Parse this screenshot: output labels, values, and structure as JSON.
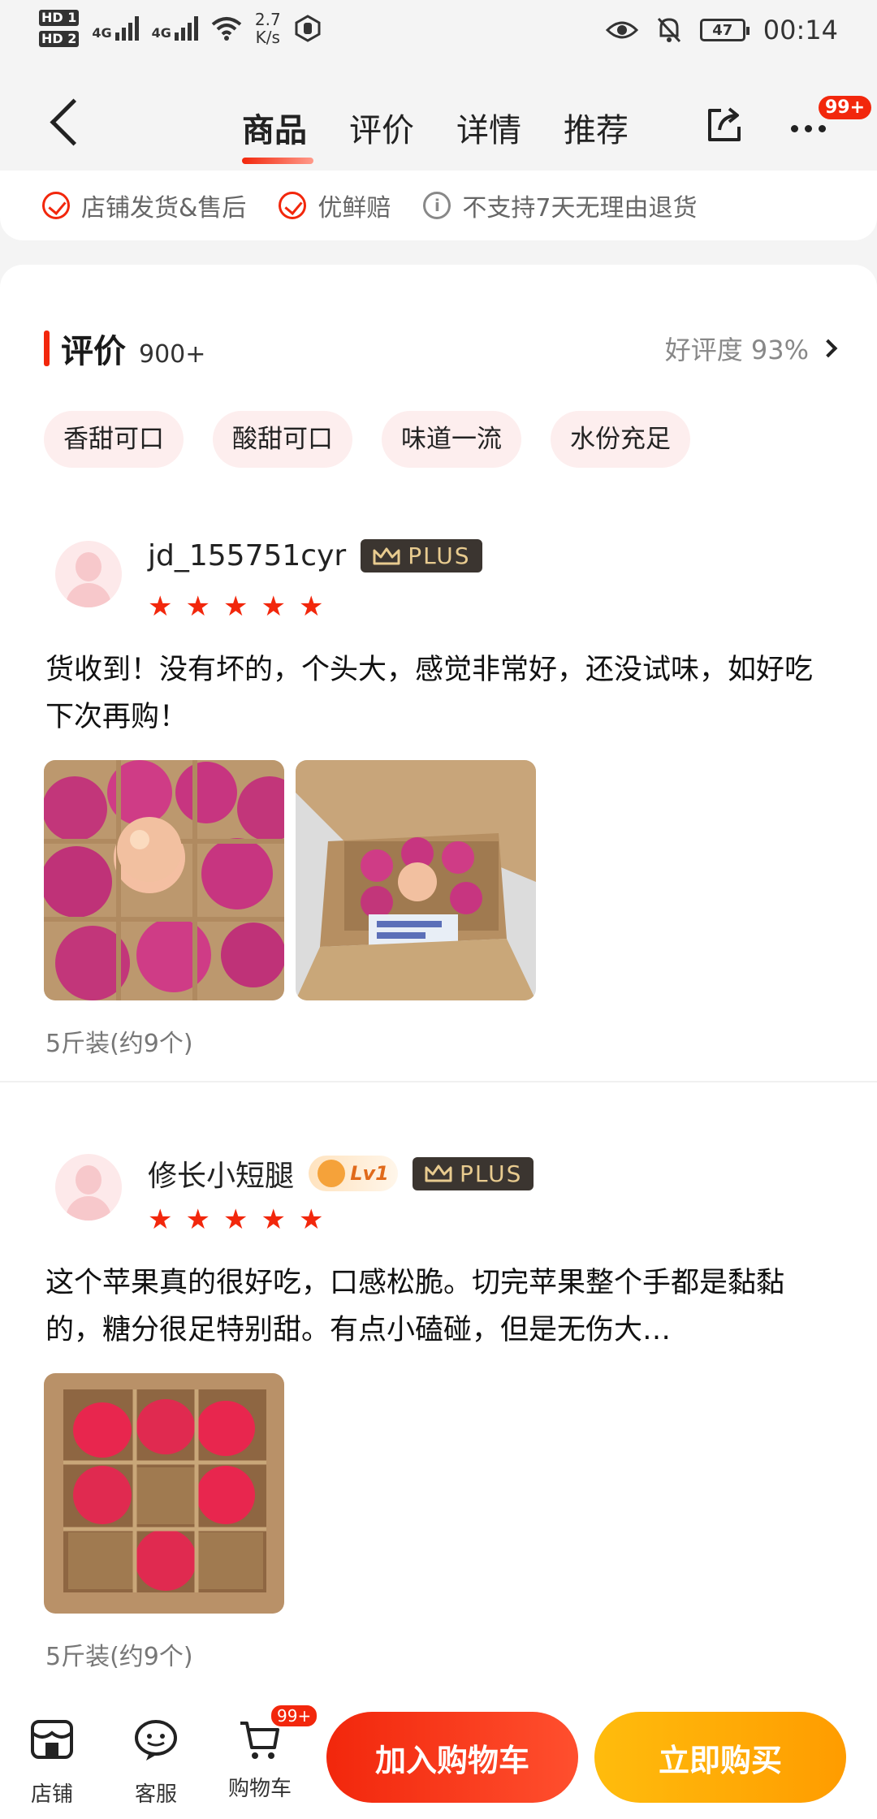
{
  "status_bar": {
    "network_label_1": "4G",
    "network_label_2": "4G",
    "speed_value": "2.7",
    "speed_unit": "K/s",
    "battery": "47",
    "time": "00:14",
    "hd1": "HD 1",
    "hd2": "HD 2"
  },
  "nav": {
    "tabs": [
      {
        "label": "商品",
        "active": true
      },
      {
        "label": "评价",
        "active": false
      },
      {
        "label": "详情",
        "active": false
      },
      {
        "label": "推荐",
        "active": false
      }
    ],
    "more_badge": "99+"
  },
  "services": [
    {
      "label": "店铺发货&售后",
      "icon": "check-circle-icon"
    },
    {
      "label": "优鲜赔",
      "icon": "check-circle-icon"
    },
    {
      "label": "不支持7天无理由退货",
      "icon": "info-icon"
    }
  ],
  "reviews_section": {
    "title": "评价",
    "count": "900+",
    "good_rate": "好评度 93%",
    "tags": [
      "香甜可口",
      "酸甜可口",
      "味道一流",
      "水份充足"
    ]
  },
  "reviews": [
    {
      "username": "jd_155751cyr",
      "plus_label": "PLUS",
      "stars": 5,
      "text": "货收到！没有坏的，个头大，感觉非常好，还没试味，如好吃下次再购！",
      "spec": "5斤装(约9个)"
    },
    {
      "username": "修长小短腿",
      "level_label": "Lv1",
      "plus_label": "PLUS",
      "stars": 5,
      "text": "这个苹果真的很好吃，口感松脆。切完苹果整个手都是黏黏的，糖分很足特别甜。有点小磕碰，但是无伤大…",
      "spec": "5斤装(约9个)"
    }
  ],
  "bottom_bar": {
    "store_label": "店铺",
    "service_label": "客服",
    "cart_label": "购物车",
    "cart_badge": "99+",
    "add_to_cart": "加入购物车",
    "buy_now": "立即购买"
  },
  "colors": {
    "accent": "#f2270c",
    "buy": "#ffa800",
    "tag_bg": "#fdeeee"
  }
}
